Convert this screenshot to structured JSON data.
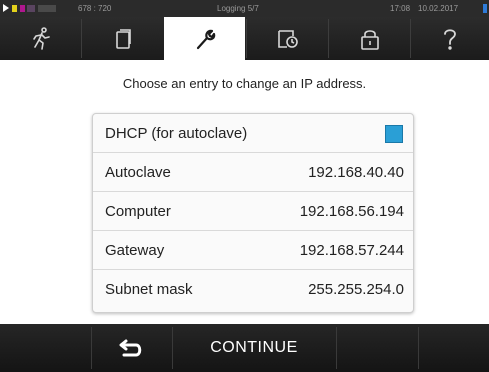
{
  "status_bar": {
    "coords": "678 : 720",
    "logging": "Logging 5/7",
    "time": "17:08",
    "date": "10.02.2017"
  },
  "toolbar": {
    "tabs": [
      {
        "icon": "running-person-icon"
      },
      {
        "icon": "document-icon"
      },
      {
        "icon": "wrench-icon",
        "active": true
      },
      {
        "icon": "clipboard-clock-icon"
      },
      {
        "icon": "padlock-icon"
      },
      {
        "icon": "help-icon"
      }
    ]
  },
  "main": {
    "instruction": "Choose an entry to change an IP address.",
    "dhcp": {
      "label": "DHCP (for autoclave)",
      "checked": true
    },
    "rows": [
      {
        "label": "Autoclave",
        "value": "192.168.40.40"
      },
      {
        "label": "Computer",
        "value": "192.168.56.194"
      },
      {
        "label": "Gateway",
        "value": "192.168.57.244"
      },
      {
        "label": "Subnet mask",
        "value": "255.255.254.0"
      }
    ]
  },
  "bottom_bar": {
    "back_icon": "back-arrow-icon",
    "continue_label": "CONTINUE"
  },
  "colors": {
    "accent": "#2a9fd6",
    "bar_bg": "#1e1e1e"
  }
}
